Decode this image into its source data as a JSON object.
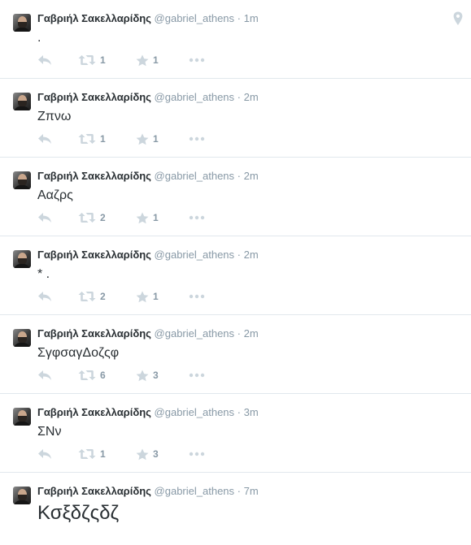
{
  "tweets": [
    {
      "fullname": "Γαβριήλ Σακελλαρίδης",
      "username": "@gabriel_athens",
      "sep": "·",
      "time": "1m",
      "text": ".",
      "retweets": "1",
      "favorites": "1",
      "big": false
    },
    {
      "fullname": "Γαβριήλ Σακελλαρίδης",
      "username": "@gabriel_athens",
      "sep": "·",
      "time": "2m",
      "text": "Ζπνω",
      "retweets": "1",
      "favorites": "1",
      "big": false
    },
    {
      "fullname": "Γαβριήλ Σακελλαρίδης",
      "username": "@gabriel_athens",
      "sep": "·",
      "time": "2m",
      "text": "Ααζρς",
      "retweets": "2",
      "favorites": "1",
      "big": false
    },
    {
      "fullname": "Γαβριήλ Σακελλαρίδης",
      "username": "@gabriel_athens",
      "sep": "·",
      "time": "2m",
      "text": "* .",
      "retweets": "2",
      "favorites": "1",
      "big": false
    },
    {
      "fullname": "Γαβριήλ Σακελλαρίδης",
      "username": "@gabriel_athens",
      "sep": "·",
      "time": "2m",
      "text": "ΣγφσαγΔοζςφ",
      "retweets": "6",
      "favorites": "3",
      "big": false
    },
    {
      "fullname": "Γαβριήλ Σακελλαρίδης",
      "username": "@gabriel_athens",
      "sep": "·",
      "time": "3m",
      "text": "ΣΝν",
      "retweets": "1",
      "favorites": "3",
      "big": false
    },
    {
      "fullname": "Γαβριήλ Σακελλαρίδης",
      "username": "@gabriel_athens",
      "sep": "·",
      "time": "7m",
      "text": "Κσξδζςδζ",
      "retweets": "",
      "favorites": "",
      "big": true
    }
  ],
  "icons": {
    "avatar": "profile-photo",
    "reply": "reply-icon",
    "retweet": "retweet-icon",
    "favorite": "star-icon",
    "more": "more-dots-icon",
    "geo": "location-pin-icon"
  },
  "colors": {
    "name": "#292f33",
    "muted": "#8899a6",
    "icon": "#ccd6dd",
    "divider": "#e1e8ed"
  }
}
